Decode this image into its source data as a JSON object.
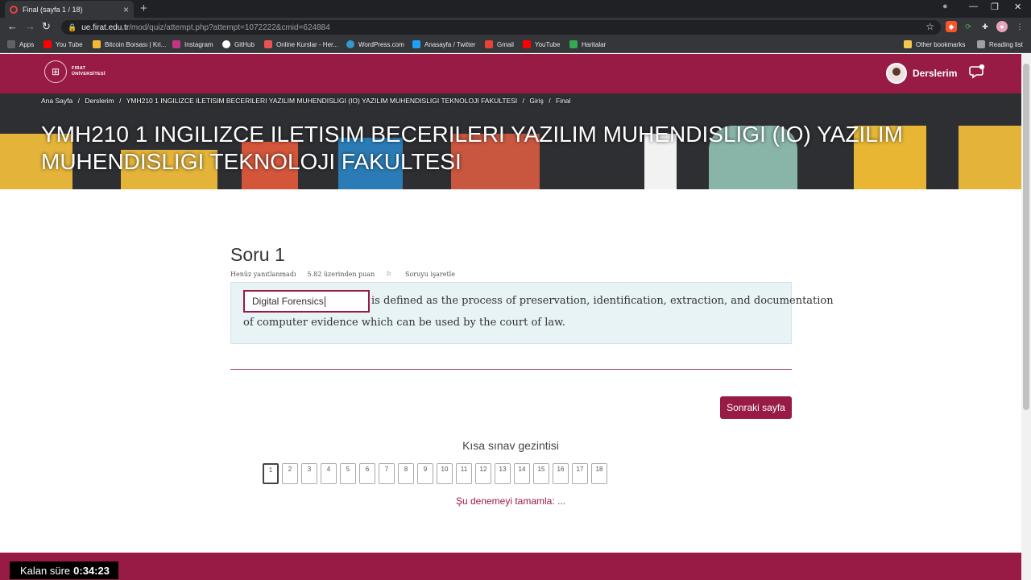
{
  "browser": {
    "tab_title": "Final (sayfa 1 / 18)",
    "url_domain": "ue.firat.edu.tr",
    "url_path": "/mod/quiz/attempt.php?attempt=1072222&cmid=624884",
    "bookmarks": [
      {
        "label": "Apps",
        "color": "#4285f4"
      },
      {
        "label": "You Tube",
        "color": "#ff0000"
      },
      {
        "label": "Bitcoin Borsası | Kri...",
        "color": "#f3ba2f"
      },
      {
        "label": "Instagram",
        "color": "#c13584"
      },
      {
        "label": "GitHub",
        "color": "#ffffff"
      },
      {
        "label": "Online Kurslar - Her...",
        "color": "#ec5252"
      },
      {
        "label": "WordPress.com",
        "color": "#3499cd"
      },
      {
        "label": "Anasayfa / Twitter",
        "color": "#1da1f2"
      },
      {
        "label": "Gmail",
        "color": "#ea4335"
      },
      {
        "label": "YouTube",
        "color": "#ff0000"
      },
      {
        "label": "Haritalar",
        "color": "#34a853"
      }
    ],
    "other_bookmarks": "Other bookmarks",
    "reading_list": "Reading list"
  },
  "header": {
    "logo_line1": "FIRAT",
    "logo_line2": "ÜNİVERSİTESİ",
    "user_label": "Derslerim"
  },
  "breadcrumb": [
    "Ana Sayfa",
    "/",
    "Derslerim",
    "/",
    "YMH210 1 INGILIZCE ILETISIM BECERILERI YAZILIM MUHENDISLIGI (IO) YAZILIM MUHENDISLIGI TEKNOLOJI FAKULTESI",
    "/",
    "Giriş",
    "/",
    "Final"
  ],
  "course_title": "YMH210 1 INGILIZCE ILETISIM BECERILERI YAZILIM MUHENDISLIGI (IO) YAZILIM MUHENDISLIGI TEKNOLOJI FAKULTESI",
  "question": {
    "heading": "Soru 1",
    "status": "Henüz yanıtlanmadı",
    "points": "5.82 üzerinden puan",
    "flag": "Soruyu işaretle",
    "answer_value": "Digital Forensics",
    "text_line1": "is defined as the process of preservation, identification, extraction, and documentation",
    "text_line2": "of computer evidence which can be used by the court of law."
  },
  "next_button": "Sonraki sayfa",
  "quiz_nav": {
    "title": "Kısa sınav gezintisi",
    "pages": [
      "1",
      "2",
      "3",
      "4",
      "5",
      "6",
      "7",
      "8",
      "9",
      "10",
      "11",
      "12",
      "13",
      "14",
      "15",
      "16",
      "17",
      "18"
    ],
    "current": "1",
    "finish_link": "Şu denemeyi tamamla: ..."
  },
  "timer": {
    "label": "Kalan süre",
    "value": "0:34:23"
  }
}
